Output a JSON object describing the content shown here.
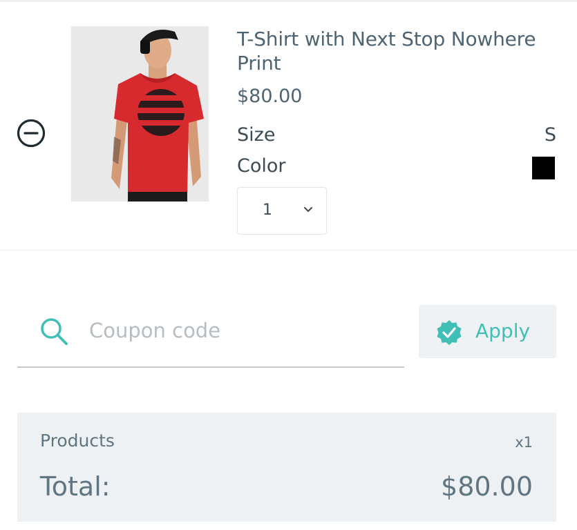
{
  "cart_item": {
    "title": "T-Shirt with Next Stop Nowhere Print",
    "price": "$80.00",
    "size_label": "Size",
    "size_value": "S",
    "color_label": "Color",
    "color_value": "#000000",
    "quantity": "1",
    "image": "red-tshirt-model-photo",
    "remove_icon": "minus-circle-icon"
  },
  "coupon": {
    "placeholder": "Coupon code",
    "value": "",
    "icon": "search-icon",
    "apply_label": "Apply",
    "apply_icon": "check-badge-icon"
  },
  "summary": {
    "products_label": "Products",
    "products_count": "x1",
    "total_label": "Total:",
    "total_value": "$80.00"
  },
  "colors": {
    "accent": "#3fbfb5",
    "text": "#4e6472",
    "panel": "#eef1f3"
  }
}
